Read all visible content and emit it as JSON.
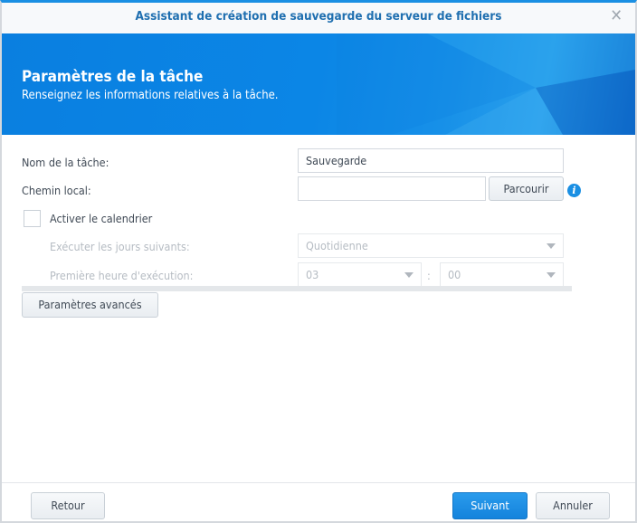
{
  "window": {
    "title": "Assistant de création de sauvegarde du serveur de fichiers",
    "close_icon": "close-icon"
  },
  "banner": {
    "title": "Paramètres de la tâche",
    "subtitle": "Renseignez les informations relatives à la tâche."
  },
  "form": {
    "task_name_label": "Nom de la tâche:",
    "task_name_value": "Sauvegarde",
    "local_path_label": "Chemin local:",
    "local_path_value": "",
    "browse_label": "Parcourir",
    "schedule_label": "Activer le calendrier",
    "schedule_checked": false,
    "days_label": "Exécuter les jours suivants:",
    "days_value": "Quotidienne",
    "first_time_label": "Première heure d'exécution:",
    "hour_value": "03",
    "separator": ":",
    "minute_value": "00",
    "advanced_label": "Paramètres avancés"
  },
  "footer": {
    "back": "Retour",
    "next": "Suivant",
    "cancel": "Annuler"
  },
  "colors": {
    "accent": "#0b86e6",
    "primary_button": "#1a8fe3"
  }
}
